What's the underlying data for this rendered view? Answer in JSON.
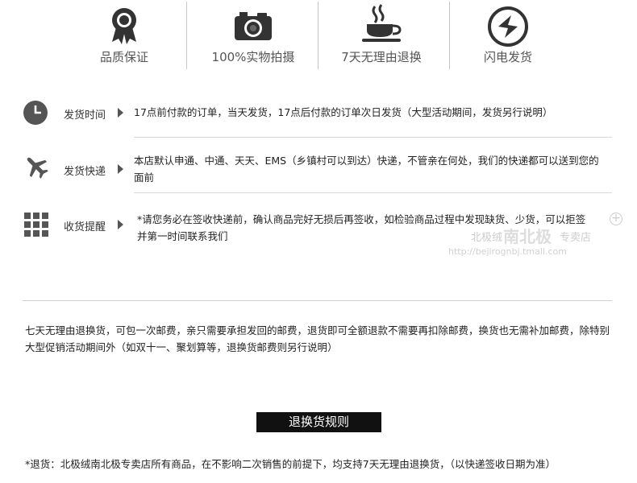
{
  "features": [
    {
      "label": "品质保证",
      "icon": "award-ribbon-icon"
    },
    {
      "label": "100%实物拍摄",
      "icon": "camera-icon"
    },
    {
      "label": "7天无理由退换",
      "icon": "coffee-cup-icon"
    },
    {
      "label": "闪电发货",
      "icon": "lightning-icon"
    }
  ],
  "rows": [
    {
      "label": "发货时间",
      "text": "17点前付款的订单，当天发货，17点后付款的订单次日发货（大型活动期间，发货另行说明）",
      "icon": "clock-icon"
    },
    {
      "label": "发货快递",
      "text": "本店默认申通、中通、天天、EMS（乡镇村可以到达）快递，不管亲在何处，我们的快递都可以送到您的面前",
      "icon": "airplane-icon"
    },
    {
      "label": "收货提醒",
      "text": "*请您务必在签收快递前，确认商品完好无损后再签收，如检验商品过程中发现缺货、少货，可以拒签并第一时间联系我们",
      "icon": "grid-icon"
    }
  ],
  "watermark": {
    "name_a": "北极绒",
    "name_b": "南北极",
    "name_c": "专卖店",
    "url": "http://bejirognbj.tmall.com"
  },
  "policy": "七天无理由退换货，可包一次邮费，亲只需要承担发回的邮费，退货即可全额退款不需要再扣除邮费，换货也无需补加邮费，除特别大型促销活动期间外（如双十一、聚划算等，退换货邮费则另行说明）",
  "rules_title": "退换货规则",
  "rules_text": "*退货：北极绒南北极专卖店所有商品，在不影响二次销售的前提下，均支持7天无理由退换货，（以快递签收日期为准）"
}
